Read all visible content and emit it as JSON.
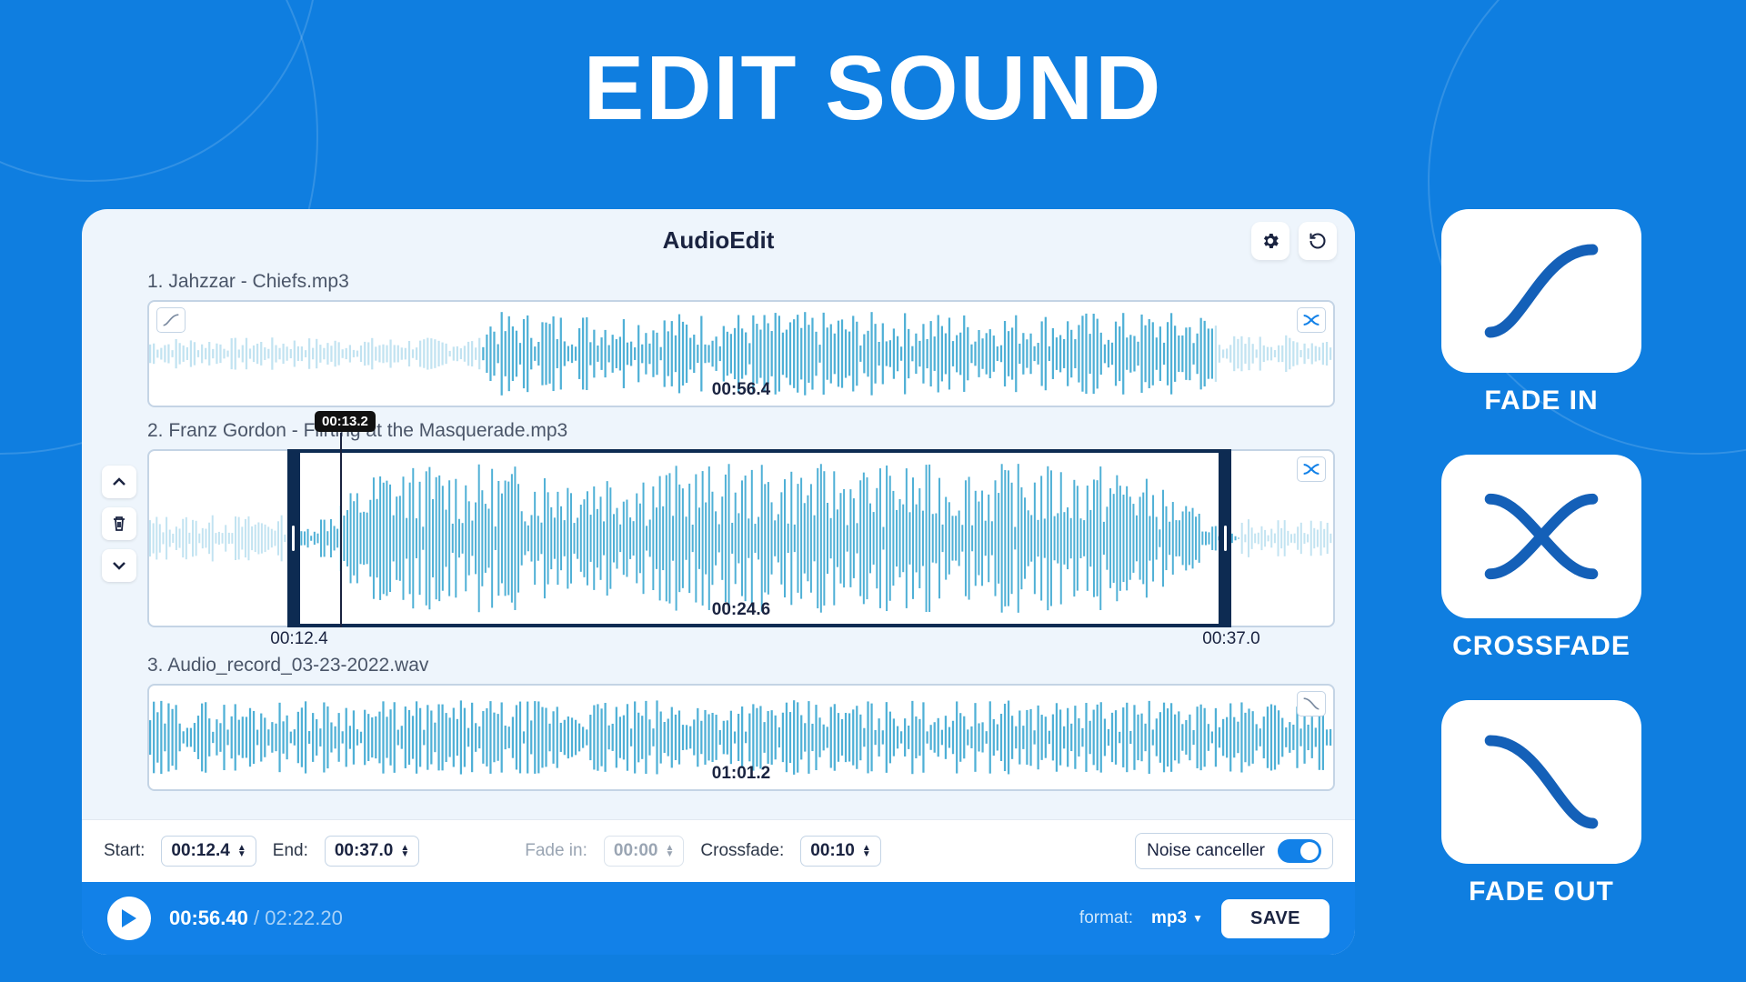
{
  "hero": {
    "title": "EDIT SOUND"
  },
  "app": {
    "title": "AudioEdit",
    "tracks": [
      {
        "title": "1. Jahzzar - Chiefs.mp3",
        "duration": "00:56.4"
      },
      {
        "title": "2. Franz Gordon - Flirting at the Masquerade.mp3",
        "duration": "00:24.6",
        "sel_start": "00:12.4",
        "sel_end": "00:37.0",
        "playhead": "00:13.2"
      },
      {
        "title": "3. Audio_record_03-23-2022.wav",
        "duration": "01:01.2"
      }
    ],
    "controls": {
      "start_label": "Start:",
      "start": "00:12.4",
      "end_label": "End:",
      "end": "00:37.0",
      "fadein_label": "Fade in:",
      "fadein": "00:00",
      "crossfade_label": "Crossfade:",
      "crossfade": "00:10",
      "noise_label": "Noise canceller",
      "noise_on": true
    },
    "playbar": {
      "current": "00:56.40",
      "total": "02:22.20",
      "format_label": "format:",
      "format": "mp3",
      "save": "SAVE"
    }
  },
  "features": [
    {
      "label": "FADE IN"
    },
    {
      "label": "CROSSFADE"
    },
    {
      "label": "FADE OUT"
    }
  ],
  "colors": {
    "accent": "#1281e8",
    "dark": "#0d2b52"
  }
}
